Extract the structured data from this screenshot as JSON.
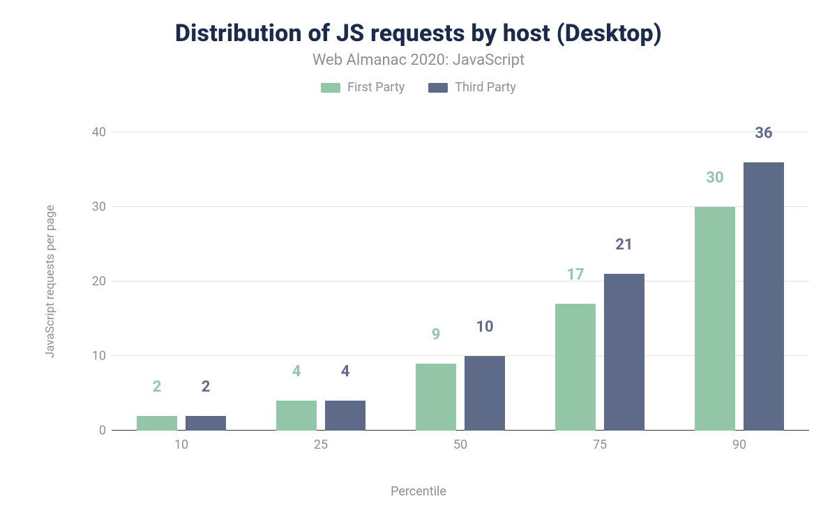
{
  "chart_data": {
    "type": "bar",
    "title": "Distribution of JS requests by host (Desktop)",
    "subtitle": "Web Almanac 2020: JavaScript",
    "xlabel": "Percentile",
    "ylabel": "JavaScript requests per page",
    "ylim": [
      0,
      40
    ],
    "y_ticks": [
      0,
      10,
      20,
      30,
      40
    ],
    "categories": [
      "10",
      "25",
      "50",
      "75",
      "90"
    ],
    "series": [
      {
        "name": "First Party",
        "color": "#92C6A6",
        "values": [
          2,
          4,
          9,
          17,
          30
        ]
      },
      {
        "name": "Third Party",
        "color": "#5D6B89",
        "values": [
          2,
          4,
          10,
          21,
          36
        ]
      }
    ],
    "legend_position": "top",
    "grid": true
  }
}
